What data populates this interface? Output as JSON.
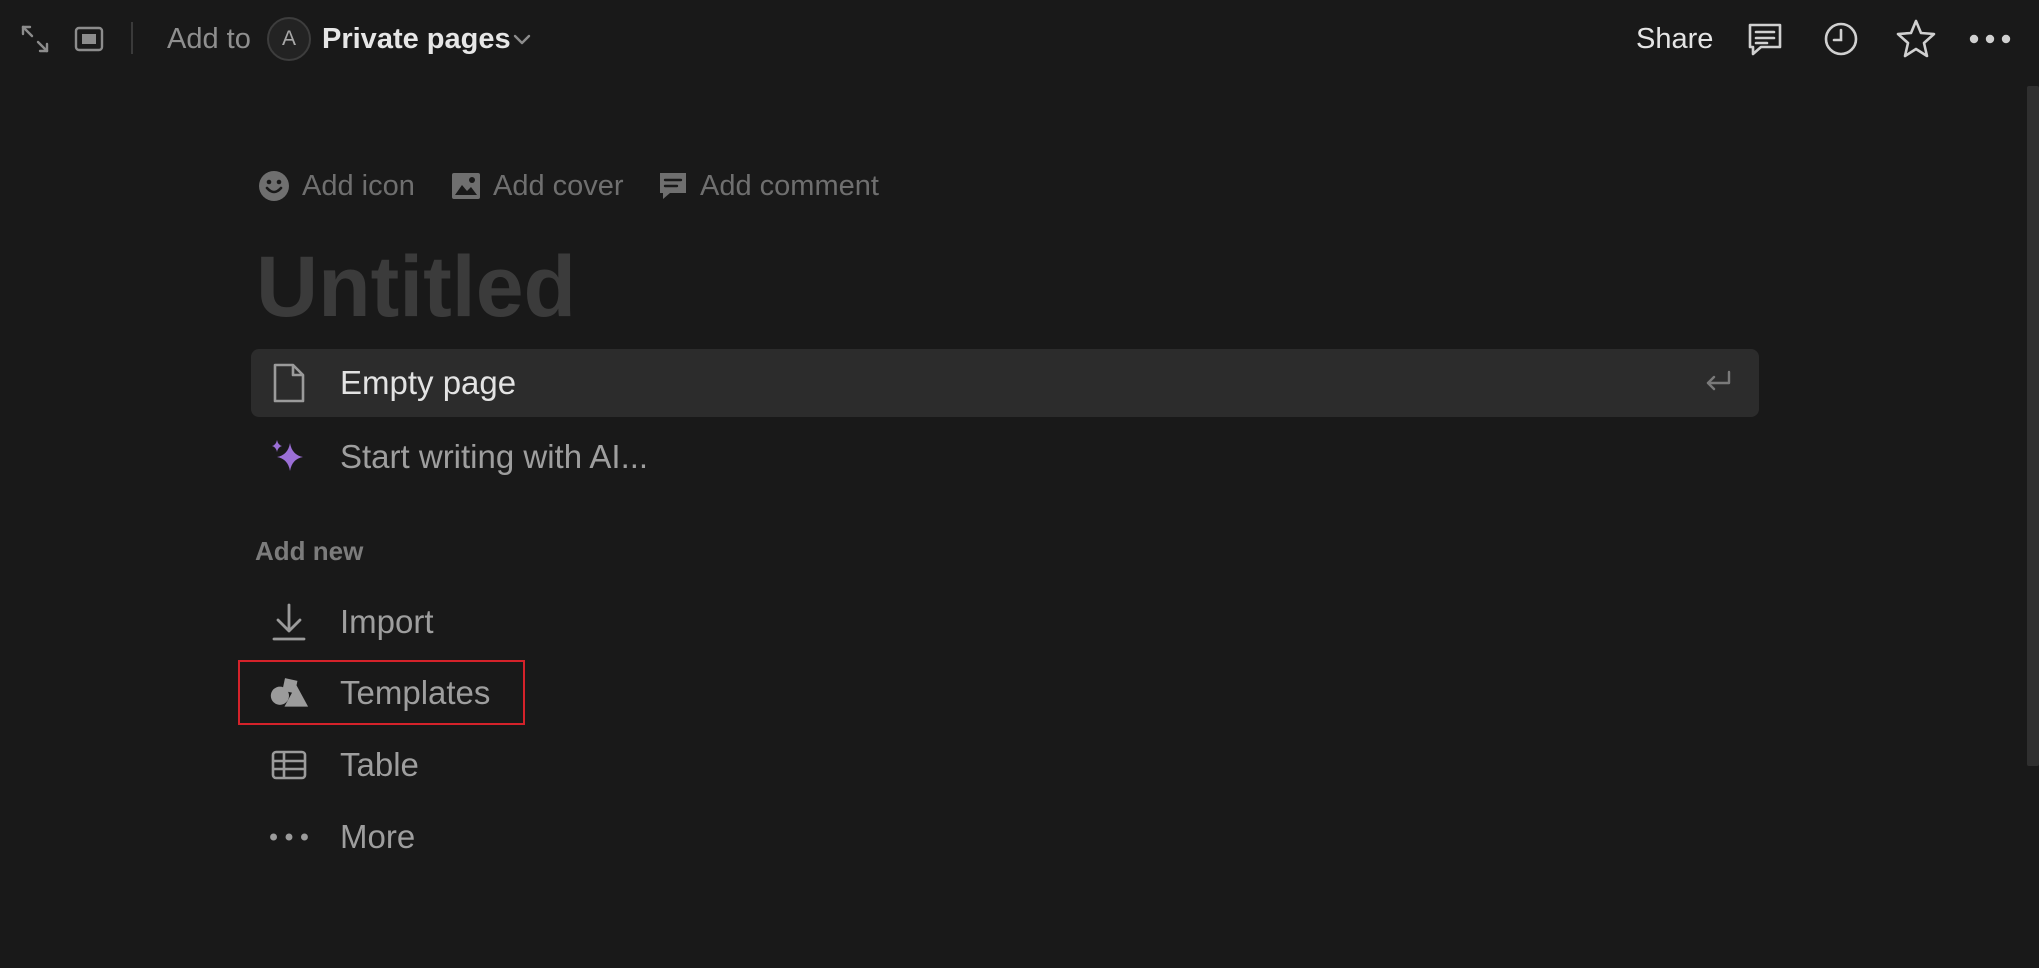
{
  "topbar": {
    "add_to_label": "Add to",
    "avatar_initial": "A",
    "workspace_name": "Private pages",
    "share_label": "Share",
    "icons": [
      "expand-icon",
      "sidebar-peek-icon",
      "chevron-down-icon",
      "comments-icon",
      "history-icon",
      "favorite-star-icon",
      "more-options-icon"
    ]
  },
  "page_actions": {
    "add_icon": "Add icon",
    "add_cover": "Add cover",
    "add_comment": "Add comment"
  },
  "page": {
    "title_placeholder": "Untitled"
  },
  "options": [
    {
      "label": "Empty page",
      "icon": "document-icon",
      "selected": true
    },
    {
      "label": "Start writing with AI...",
      "icon": "ai-sparkle-icon",
      "selected": false
    }
  ],
  "add_new": {
    "heading": "Add new",
    "items": [
      {
        "label": "Import",
        "icon": "import-icon"
      },
      {
        "label": "Templates",
        "icon": "templates-icon",
        "highlighted": true
      },
      {
        "label": "Table",
        "icon": "table-icon"
      },
      {
        "label": "More",
        "icon": "more-dots-icon"
      }
    ]
  },
  "colors": {
    "background": "#191919",
    "selected_row": "#2c2c2c",
    "ai_accent": "#9b6fd6",
    "highlight_border": "#d4222a"
  }
}
